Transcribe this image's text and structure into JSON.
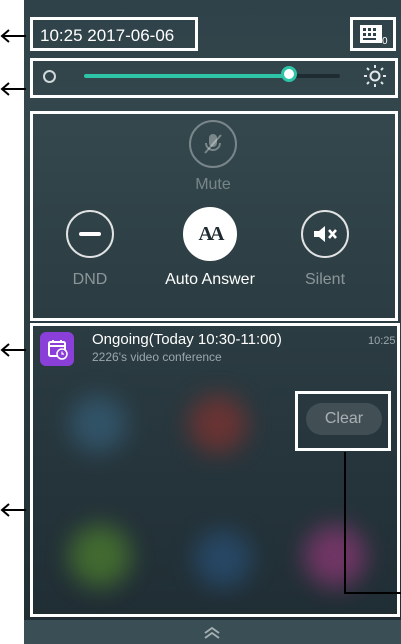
{
  "status_bar": {
    "datetime": "10:25 2017-06-06",
    "keyboard_badge": "0"
  },
  "brightness": {
    "level_fraction": 0.8
  },
  "quick_actions": {
    "mute": {
      "label": "Mute",
      "icon": "microphone-muted-icon",
      "active": false
    },
    "dnd": {
      "label": "DND",
      "icon": "minus-circle-icon",
      "active": false
    },
    "auto_answer": {
      "label": "Auto Answer",
      "icon": "auto-answer-icon",
      "glyph": "AA",
      "active": true
    },
    "silent": {
      "label": "Silent",
      "icon": "speaker-muted-icon",
      "active": false
    }
  },
  "notification": {
    "title": "Ongoing(Today 10:30-11:00)",
    "subtitle": "2226's video conference",
    "time": "10:25",
    "app_icon": "calendar-icon",
    "app_icon_color": "#8a3fd8"
  },
  "clear_button": {
    "label": "Clear"
  },
  "colors": {
    "accent": "#2ec4a8",
    "annotation": "#ffffff"
  }
}
